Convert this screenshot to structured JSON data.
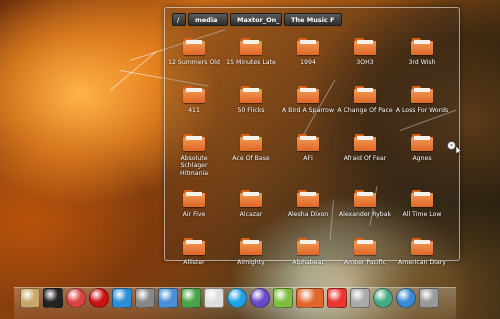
{
  "window": {
    "breadcrumbs": [
      {
        "label": "/",
        "cls": "root"
      },
      {
        "label": "media",
        "cls": "c1"
      },
      {
        "label": "Maxtor_On_",
        "cls": "c2"
      },
      {
        "label": "The Music F",
        "cls": "c3"
      }
    ],
    "folders": [
      {
        "name": "12 Summers Old"
      },
      {
        "name": "15 Minutes Late"
      },
      {
        "name": "1994"
      },
      {
        "name": "3OH3"
      },
      {
        "name": "3rd Wish"
      },
      {
        "name": "411"
      },
      {
        "name": "50 Flicks"
      },
      {
        "name": "A Bird A Sparrow"
      },
      {
        "name": "A Change Of Pace"
      },
      {
        "name": "A Loss For Words"
      },
      {
        "name": "Absolute Schlager Hitmania"
      },
      {
        "name": "Ace Of Base"
      },
      {
        "name": "AFI"
      },
      {
        "name": "Afraid Of Fear"
      },
      {
        "name": "Agnes"
      },
      {
        "name": "Air Five"
      },
      {
        "name": "Alcazar"
      },
      {
        "name": "Alesha Dixon"
      },
      {
        "name": "Alexander Rybak"
      },
      {
        "name": "All Time Low"
      },
      {
        "name": "Allister"
      },
      {
        "name": "Almighty"
      },
      {
        "name": "Alphabeat"
      },
      {
        "name": "Amber Pacific"
      },
      {
        "name": "American Diary"
      }
    ]
  },
  "colors": {
    "folder_orange": "#f39a52",
    "folder_dark": "#e0662a"
  },
  "dock": {
    "icons": [
      "anchor-icon",
      "terminal-icon",
      "chrome-icon",
      "opera-icon",
      "skype-b-icon",
      "printer-icon",
      "network-icon",
      "people-icon",
      "pinwheel-icon",
      "skype-icon",
      "media-player-icon",
      "move-icon",
      "folder-icon",
      "gmail-icon",
      "settings-gear-icon",
      "clock-icon",
      "refresh-icon",
      "trash-icon"
    ]
  }
}
